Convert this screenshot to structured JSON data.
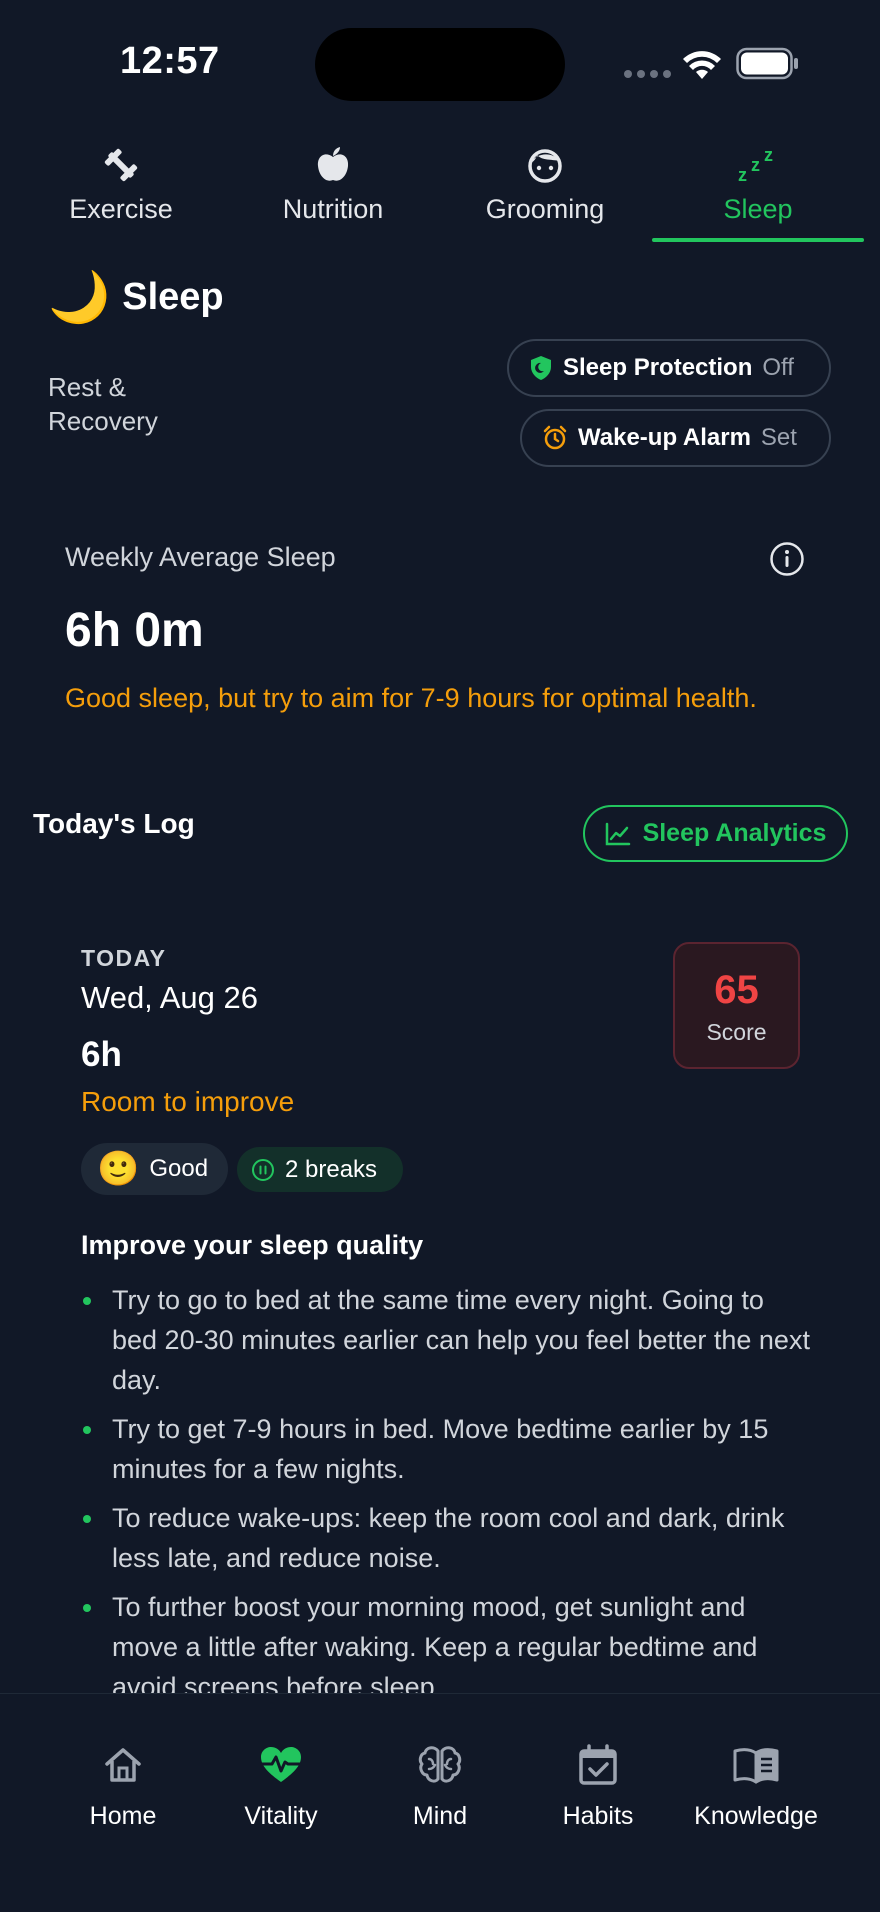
{
  "status_bar": {
    "time": "12:57"
  },
  "tabs": [
    {
      "label": "Exercise",
      "icon": "dumbbell-icon"
    },
    {
      "label": "Nutrition",
      "icon": "apple-icon"
    },
    {
      "label": "Grooming",
      "icon": "face-icon"
    },
    {
      "label": "Sleep",
      "icon": "zzz-icon",
      "active": true
    }
  ],
  "header": {
    "emoji": "🌙",
    "title": "Sleep",
    "subtitle": "Rest & Recovery",
    "protection": {
      "label": "Sleep Protection",
      "value": "Off",
      "icon": "shield-icon"
    },
    "alarm": {
      "label": "Wake-up Alarm",
      "value": "Set",
      "icon": "alarm-clock-icon"
    }
  },
  "weekly": {
    "label": "Weekly Average Sleep",
    "value": "6h 0m",
    "note": "Good sleep, but try to aim for 7-9 hours for optimal health."
  },
  "log": {
    "title": "Today's Log",
    "analytics_button": "Sleep Analytics"
  },
  "day": {
    "label": "TODAY",
    "date": "Wed, Aug 26",
    "hours": "6h",
    "status": "Room to improve",
    "score": "65",
    "score_label": "Score",
    "mood_emoji": "🙂",
    "mood": "Good",
    "breaks": "2 breaks"
  },
  "improve": {
    "title": "Improve your sleep quality",
    "tips": [
      "Try to go to bed at the same time every night. Going to bed 20-30 minutes earlier can help you feel better the next day.",
      "Try to get 7-9 hours in bed. Move bedtime earlier by 15 minutes for a few nights.",
      "To reduce wake-ups: keep the room cool and dark, drink less late, and reduce noise.",
      "To further boost your morning mood, get sunlight and move a little after waking. Keep a regular bedtime and avoid screens before sleep."
    ]
  },
  "bottom_nav": [
    {
      "label": "Home",
      "icon": "home-icon"
    },
    {
      "label": "Vitality",
      "icon": "heart-pulse-icon",
      "active": true
    },
    {
      "label": "Mind",
      "icon": "brain-icon"
    },
    {
      "label": "Habits",
      "icon": "calendar-check-icon"
    },
    {
      "label": "Knowledge",
      "icon": "book-icon"
    }
  ],
  "colors": {
    "background": "#111827",
    "accent": "#22c55e",
    "warning": "#f59e0b",
    "score": "#ef4444"
  }
}
